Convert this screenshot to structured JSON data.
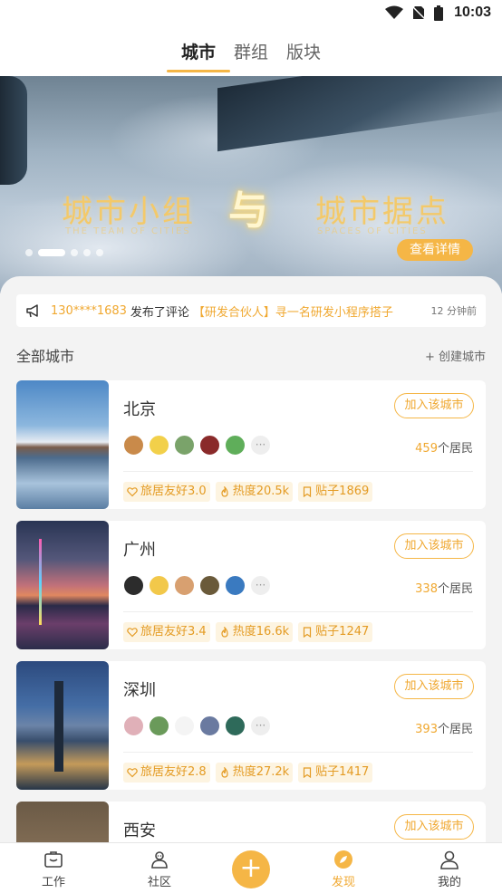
{
  "status_bar": {
    "time": "10:03"
  },
  "top_tabs": [
    {
      "label": "城市",
      "active": true
    },
    {
      "label": "群组",
      "active": false
    },
    {
      "label": "版块",
      "active": false
    }
  ],
  "banner": {
    "title_left": "城市小组",
    "symbol": "与",
    "title_right": "城市据点",
    "subtitle_left": "THE TEAM OF CITIES",
    "subtitle_right": "SPACES OF CITIES",
    "detail_button": "查看详情"
  },
  "notice": {
    "user": "130****1683",
    "action": "发布了评论",
    "topic": "【研发合伙人】寻一名研发小程序搭子",
    "time": "12 分钟前"
  },
  "section": {
    "title": "全部城市",
    "create": "+ 创建城市"
  },
  "cities": [
    {
      "name": "北京",
      "join": "加入该城市",
      "residents": "459",
      "residents_suffix": "个居民",
      "friendly": "旅居友好3.0",
      "heat": "热度20.5k",
      "posts": "贴子1869"
    },
    {
      "name": "广州",
      "join": "加入该城市",
      "residents": "338",
      "residents_suffix": "个居民",
      "friendly": "旅居友好3.4",
      "heat": "热度16.6k",
      "posts": "贴子1247"
    },
    {
      "name": "深圳",
      "join": "加入该城市",
      "residents": "393",
      "residents_suffix": "个居民",
      "friendly": "旅居友好2.8",
      "heat": "热度27.2k",
      "posts": "贴子1417"
    },
    {
      "name": "西安",
      "join": "加入该城市"
    }
  ],
  "more_avatars": "···",
  "bottom_nav": [
    {
      "label": "工作",
      "icon": "briefcase-icon"
    },
    {
      "label": "社区",
      "icon": "community-icon"
    },
    {
      "label": "发现",
      "icon": "compass-icon",
      "active": true
    },
    {
      "label": "我的",
      "icon": "user-icon"
    }
  ],
  "colors": {
    "accent": "#f5b646",
    "accent_text": "#f0a830",
    "tag_bg": "#fdf4e1"
  }
}
